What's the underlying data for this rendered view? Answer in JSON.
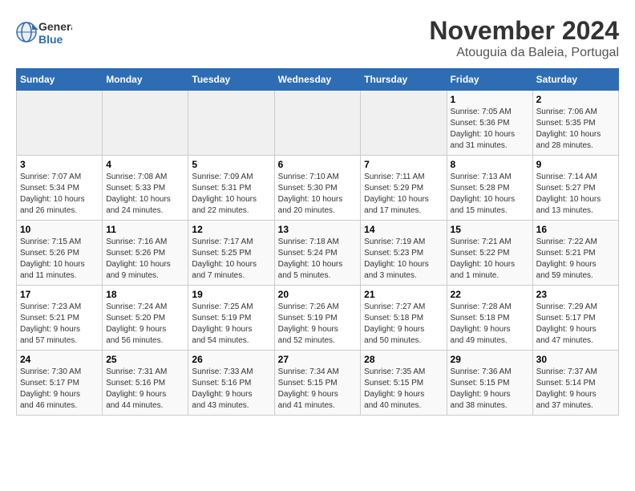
{
  "logo": {
    "line1": "General",
    "line2": "Blue"
  },
  "title": "November 2024",
  "subtitle": "Atouguia da Baleia, Portugal",
  "weekdays": [
    "Sunday",
    "Monday",
    "Tuesday",
    "Wednesday",
    "Thursday",
    "Friday",
    "Saturday"
  ],
  "weeks": [
    [
      {
        "day": "",
        "info": ""
      },
      {
        "day": "",
        "info": ""
      },
      {
        "day": "",
        "info": ""
      },
      {
        "day": "",
        "info": ""
      },
      {
        "day": "",
        "info": ""
      },
      {
        "day": "1",
        "info": "Sunrise: 7:05 AM\nSunset: 5:36 PM\nDaylight: 10 hours\nand 31 minutes."
      },
      {
        "day": "2",
        "info": "Sunrise: 7:06 AM\nSunset: 5:35 PM\nDaylight: 10 hours\nand 28 minutes."
      }
    ],
    [
      {
        "day": "3",
        "info": "Sunrise: 7:07 AM\nSunset: 5:34 PM\nDaylight: 10 hours\nand 26 minutes."
      },
      {
        "day": "4",
        "info": "Sunrise: 7:08 AM\nSunset: 5:33 PM\nDaylight: 10 hours\nand 24 minutes."
      },
      {
        "day": "5",
        "info": "Sunrise: 7:09 AM\nSunset: 5:31 PM\nDaylight: 10 hours\nand 22 minutes."
      },
      {
        "day": "6",
        "info": "Sunrise: 7:10 AM\nSunset: 5:30 PM\nDaylight: 10 hours\nand 20 minutes."
      },
      {
        "day": "7",
        "info": "Sunrise: 7:11 AM\nSunset: 5:29 PM\nDaylight: 10 hours\nand 17 minutes."
      },
      {
        "day": "8",
        "info": "Sunrise: 7:13 AM\nSunset: 5:28 PM\nDaylight: 10 hours\nand 15 minutes."
      },
      {
        "day": "9",
        "info": "Sunrise: 7:14 AM\nSunset: 5:27 PM\nDaylight: 10 hours\nand 13 minutes."
      }
    ],
    [
      {
        "day": "10",
        "info": "Sunrise: 7:15 AM\nSunset: 5:26 PM\nDaylight: 10 hours\nand 11 minutes."
      },
      {
        "day": "11",
        "info": "Sunrise: 7:16 AM\nSunset: 5:26 PM\nDaylight: 10 hours\nand 9 minutes."
      },
      {
        "day": "12",
        "info": "Sunrise: 7:17 AM\nSunset: 5:25 PM\nDaylight: 10 hours\nand 7 minutes."
      },
      {
        "day": "13",
        "info": "Sunrise: 7:18 AM\nSunset: 5:24 PM\nDaylight: 10 hours\nand 5 minutes."
      },
      {
        "day": "14",
        "info": "Sunrise: 7:19 AM\nSunset: 5:23 PM\nDaylight: 10 hours\nand 3 minutes."
      },
      {
        "day": "15",
        "info": "Sunrise: 7:21 AM\nSunset: 5:22 PM\nDaylight: 10 hours\nand 1 minute."
      },
      {
        "day": "16",
        "info": "Sunrise: 7:22 AM\nSunset: 5:21 PM\nDaylight: 9 hours\nand 59 minutes."
      }
    ],
    [
      {
        "day": "17",
        "info": "Sunrise: 7:23 AM\nSunset: 5:21 PM\nDaylight: 9 hours\nand 57 minutes."
      },
      {
        "day": "18",
        "info": "Sunrise: 7:24 AM\nSunset: 5:20 PM\nDaylight: 9 hours\nand 56 minutes."
      },
      {
        "day": "19",
        "info": "Sunrise: 7:25 AM\nSunset: 5:19 PM\nDaylight: 9 hours\nand 54 minutes."
      },
      {
        "day": "20",
        "info": "Sunrise: 7:26 AM\nSunset: 5:19 PM\nDaylight: 9 hours\nand 52 minutes."
      },
      {
        "day": "21",
        "info": "Sunrise: 7:27 AM\nSunset: 5:18 PM\nDaylight: 9 hours\nand 50 minutes."
      },
      {
        "day": "22",
        "info": "Sunrise: 7:28 AM\nSunset: 5:18 PM\nDaylight: 9 hours\nand 49 minutes."
      },
      {
        "day": "23",
        "info": "Sunrise: 7:29 AM\nSunset: 5:17 PM\nDaylight: 9 hours\nand 47 minutes."
      }
    ],
    [
      {
        "day": "24",
        "info": "Sunrise: 7:30 AM\nSunset: 5:17 PM\nDaylight: 9 hours\nand 46 minutes."
      },
      {
        "day": "25",
        "info": "Sunrise: 7:31 AM\nSunset: 5:16 PM\nDaylight: 9 hours\nand 44 minutes."
      },
      {
        "day": "26",
        "info": "Sunrise: 7:33 AM\nSunset: 5:16 PM\nDaylight: 9 hours\nand 43 minutes."
      },
      {
        "day": "27",
        "info": "Sunrise: 7:34 AM\nSunset: 5:15 PM\nDaylight: 9 hours\nand 41 minutes."
      },
      {
        "day": "28",
        "info": "Sunrise: 7:35 AM\nSunset: 5:15 PM\nDaylight: 9 hours\nand 40 minutes."
      },
      {
        "day": "29",
        "info": "Sunrise: 7:36 AM\nSunset: 5:15 PM\nDaylight: 9 hours\nand 38 minutes."
      },
      {
        "day": "30",
        "info": "Sunrise: 7:37 AM\nSunset: 5:14 PM\nDaylight: 9 hours\nand 37 minutes."
      }
    ]
  ]
}
